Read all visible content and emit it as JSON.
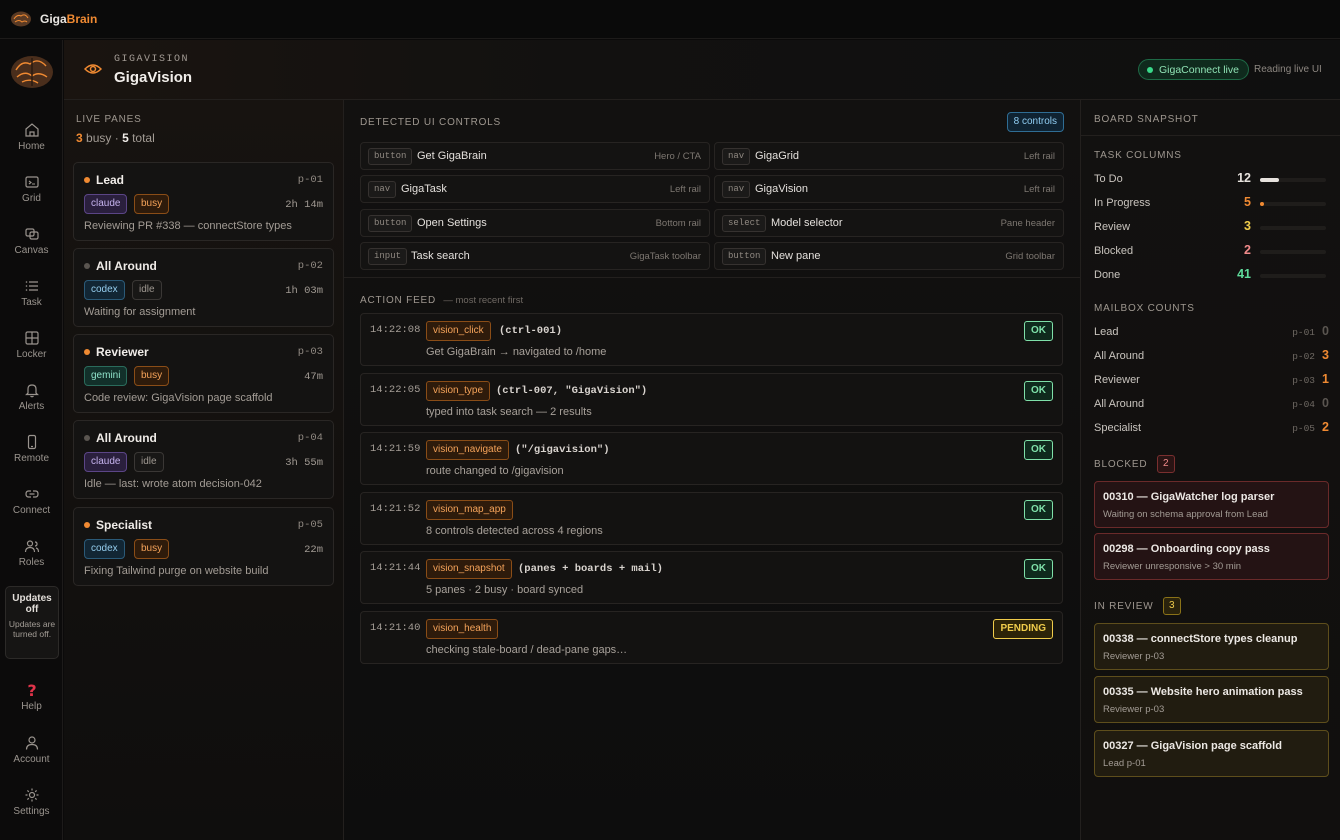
{
  "app": {
    "name_part1": "Giga",
    "name_part2": "Brain"
  },
  "rail": {
    "items": [
      {
        "label": "Home",
        "icon": "home-icon"
      },
      {
        "label": "Grid",
        "icon": "terminal-icon"
      },
      {
        "label": "Canvas",
        "icon": "canvas-icon"
      },
      {
        "label": "Task",
        "icon": "list-icon"
      },
      {
        "label": "Locker",
        "icon": "locker-icon"
      },
      {
        "label": "Alerts",
        "icon": "bell-icon"
      },
      {
        "label": "Remote",
        "icon": "phone-icon"
      },
      {
        "label": "Connect",
        "icon": "link-icon"
      },
      {
        "label": "Roles",
        "icon": "users-icon"
      }
    ],
    "updates_title": "Updates off",
    "updates_text": "Updates are turned off.",
    "bottom": [
      {
        "label": "Help",
        "icon": "help-icon"
      },
      {
        "label": "Account",
        "icon": "user-icon"
      },
      {
        "label": "Settings",
        "icon": "gear-icon"
      }
    ]
  },
  "header": {
    "eyebrow": "GIGAVISION",
    "title": "GigaVision",
    "live_label": "GigaConnect live",
    "reading_label": "Reading live UI"
  },
  "live_panes": {
    "label": "LIVE PANES",
    "busy_count": "3",
    "busy_text": "busy ·",
    "total_count": "5",
    "total_text": "total",
    "panes": [
      {
        "name": "Lead",
        "id": "p-01",
        "model": "claude",
        "status": "busy",
        "duration": "2h 14m",
        "desc": "Reviewing PR #338 — connectStore types"
      },
      {
        "name": "All Around",
        "id": "p-02",
        "model": "codex",
        "status": "idle",
        "duration": "1h 03m",
        "desc": "Waiting for assignment"
      },
      {
        "name": "Reviewer",
        "id": "p-03",
        "model": "gemini",
        "status": "busy",
        "duration": "47m",
        "desc": "Code review: GigaVision page scaffold"
      },
      {
        "name": "All Around",
        "id": "p-04",
        "model": "claude",
        "status": "idle",
        "duration": "3h 55m",
        "desc": "Idle — last: wrote atom decision-042"
      },
      {
        "name": "Specialist",
        "id": "p-05",
        "model": "codex",
        "status": "busy",
        "duration": "22m",
        "desc": "Fixing Tailwind purge on website build"
      }
    ]
  },
  "controls": {
    "label": "DETECTED UI CONTROLS",
    "count_label": "8 controls",
    "items": [
      {
        "kind": "button",
        "label": "Get GigaBrain",
        "location": "Hero / CTA"
      },
      {
        "kind": "nav",
        "label": "GigaGrid",
        "location": "Left rail"
      },
      {
        "kind": "nav",
        "label": "GigaTask",
        "location": "Left rail"
      },
      {
        "kind": "nav",
        "label": "GigaVision",
        "location": "Left rail"
      },
      {
        "kind": "button",
        "label": "Open Settings",
        "location": "Bottom rail"
      },
      {
        "kind": "select",
        "label": "Model selector",
        "location": "Pane header"
      },
      {
        "kind": "input",
        "label": "Task search",
        "location": "GigaTask toolbar"
      },
      {
        "kind": "button",
        "label": "New pane",
        "location": "Grid toolbar"
      }
    ]
  },
  "feed": {
    "label": "ACTION FEED",
    "sublabel": "— most recent first",
    "items": [
      {
        "time": "14:22:08",
        "fn": "vision_click",
        "args": "(ctrl-001)",
        "msg": "Get GigaBrain → navigated to /home",
        "status": "OK"
      },
      {
        "time": "14:22:05",
        "fn": "vision_type",
        "args": "(ctrl-007, \"GigaVision\")",
        "msg": "typed into task search — 2 results",
        "status": "OK"
      },
      {
        "time": "14:21:59",
        "fn": "vision_navigate",
        "args": "(\"/gigavision\")",
        "msg": "route changed to /gigavision",
        "status": "OK"
      },
      {
        "time": "14:21:52",
        "fn": "vision_map_app",
        "args": "",
        "msg": "8 controls detected across 4 regions",
        "status": "OK"
      },
      {
        "time": "14:21:44",
        "fn": "vision_snapshot",
        "args": "(panes + boards + mail)",
        "msg": "5 panes · 2 busy · board synced",
        "status": "OK"
      },
      {
        "time": "14:21:40",
        "fn": "vision_health",
        "args": "",
        "msg": "checking stale-board / dead-pane gaps…",
        "status": "PENDING"
      }
    ]
  },
  "snapshot": {
    "label": "BOARD SNAPSHOT",
    "task_columns_label": "TASK COLUMNS",
    "task_columns": [
      {
        "name": "To Do",
        "count": "12",
        "fraction": 0.29,
        "color": "#e6e2dd"
      },
      {
        "name": "In Progress",
        "count": "5",
        "fraction": 0.06,
        "color": "#f08a32"
      },
      {
        "name": "Review",
        "count": "3",
        "fraction": 0.0,
        "color": "#f0cc4b"
      },
      {
        "name": "Blocked",
        "count": "2",
        "fraction": 0.0,
        "color": "#f08a8a"
      },
      {
        "name": "Done",
        "count": "41",
        "fraction": 0.0,
        "color": "#5fdc9c"
      }
    ],
    "mailbox_label": "MAILBOX COUNTS",
    "mailboxes": [
      {
        "name": "Lead",
        "id": "p-01",
        "count": "0",
        "color": "#5a5550"
      },
      {
        "name": "All Around",
        "id": "p-02",
        "count": "3",
        "color": "#f08a32"
      },
      {
        "name": "Reviewer",
        "id": "p-03",
        "count": "1",
        "color": "#f08a32"
      },
      {
        "name": "All Around",
        "id": "p-04",
        "count": "0",
        "color": "#5a5550"
      },
      {
        "name": "Specialist",
        "id": "p-05",
        "count": "2",
        "color": "#f08a32"
      }
    ],
    "blocked_label": "BLOCKED",
    "blocked_count": "2",
    "blocked": [
      {
        "title": "00310 — GigaWatcher log parser",
        "sub": "Waiting on schema approval from Lead"
      },
      {
        "title": "00298 — Onboarding copy pass",
        "sub": "Reviewer unresponsive > 30 min"
      }
    ],
    "review_label": "IN REVIEW",
    "review_count": "3",
    "review": [
      {
        "title": "00338 — connectStore types cleanup",
        "sub": "Reviewer p-03"
      },
      {
        "title": "00335 — Website hero animation pass",
        "sub": "Reviewer p-03"
      },
      {
        "title": "00327 — GigaVision page scaffold",
        "sub": "Lead p-01"
      }
    ]
  }
}
